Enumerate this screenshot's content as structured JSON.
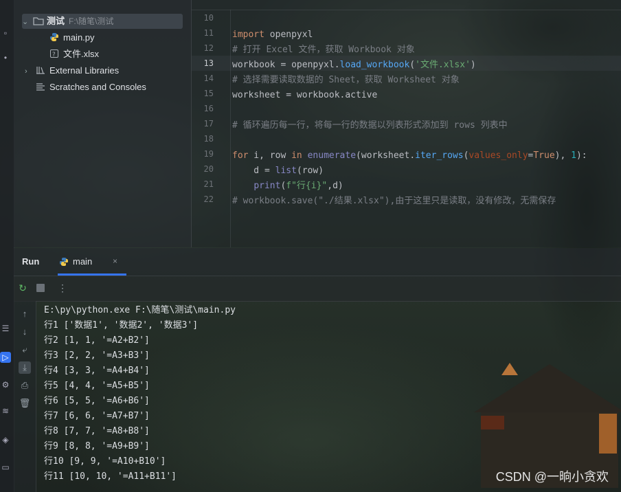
{
  "project": {
    "folder_name": "测试",
    "folder_path": "F:\\随笔\\测试",
    "files": [
      "main.py",
      "文件.xlsx"
    ],
    "external_libraries": "External Libraries",
    "scratches": "Scratches and Consoles"
  },
  "editor": {
    "line_numbers": [
      "10",
      "11",
      "12",
      "13",
      "14",
      "15",
      "16",
      "17",
      "18",
      "19",
      "20",
      "21",
      "22"
    ],
    "active_line": "13",
    "lines": [
      "",
      "import openpyxl",
      "# 打开 Excel 文件，获取 Workbook 对象",
      "workbook = openpyxl.load_workbook('文件.xlsx')",
      "# 选择需要读取数据的 Sheet，获取 Worksheet 对象",
      "worksheet = workbook.active",
      "",
      "# 循环遍历每一行，将每一行的数据以列表形式添加到 rows 列表中",
      "",
      "for i, row in enumerate(worksheet.iter_rows(values_only=True), 1):",
      "    d = list(row)",
      "    print(f\"行{i}\",d)",
      "# workbook.save(\"./结果.xlsx\"),由于这里只是读取，没有修改，无需保存"
    ]
  },
  "run": {
    "title": "Run",
    "tab_label": "main",
    "close_glyph": "×",
    "output": [
      "E:\\py\\python.exe F:\\随笔\\测试\\main.py",
      "行1 ['数据1', '数据2', '数据3']",
      "行2 [1, 1, '=A2+B2']",
      "行3 [2, 2, '=A3+B3']",
      "行4 [3, 3, '=A4+B4']",
      "行5 [4, 4, '=A5+B5']",
      "行6 [5, 5, '=A6+B6']",
      "行7 [6, 6, '=A7+B7']",
      "行8 [7, 7, '=A8+B8']",
      "行9 [8, 8, '=A9+B9']",
      "行10 [9, 9, '=A10+B10']",
      "行11 [10, 10, '=A11+B11']"
    ]
  },
  "watermark": "CSDN @一晌小贪欢",
  "colors": {
    "accent": "#3574f0",
    "keyword": "#cf8e6d",
    "comment": "#7a7e85",
    "string": "#6aab73",
    "function": "#56a8f5"
  }
}
